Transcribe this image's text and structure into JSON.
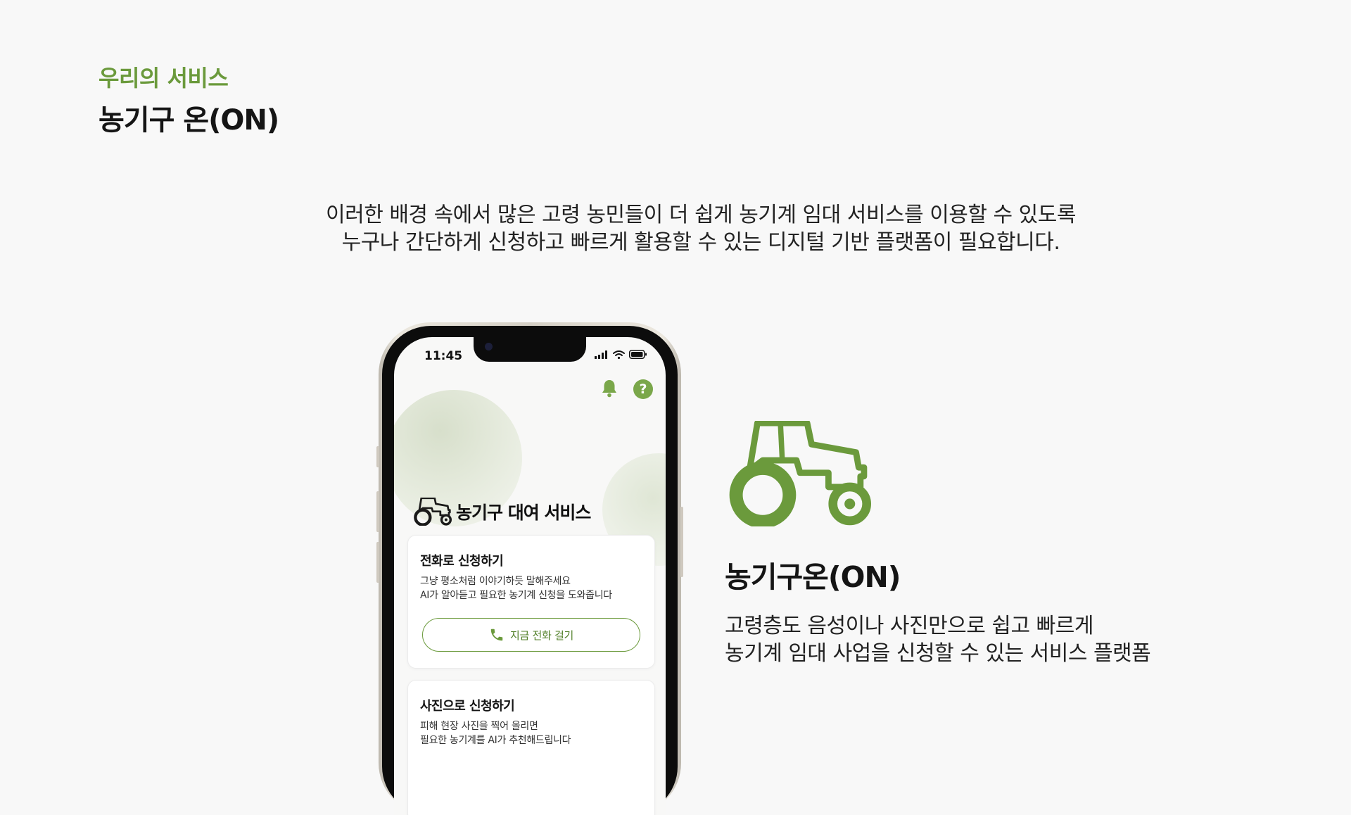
{
  "header": {
    "eyebrow": "우리의 서비스",
    "title": "농기구 온(ON)"
  },
  "intro": {
    "line1": "이러한 배경 속에서 많은 고령 농민들이 더 쉽게 농기계 임대 서비스를 이용할 수 있도록",
    "line2": "누구나 간단하게 신청하고 빠르게 활용할 수 있는 디지털 기반 플랫폼이 필요합니다."
  },
  "phone": {
    "status_time": "11:45",
    "app_title": "농기구 대여 서비스",
    "help_glyph": "?",
    "cards": [
      {
        "title": "전화로 신청하기",
        "desc_line1": "그냥 평소처럼 이야기하듯 말해주세요",
        "desc_line2": "AI가 알아듣고 필요한 농기계 신청을 도와줍니다",
        "button_label": "지금 전화 걸기"
      },
      {
        "title": "사진으로 신청하기",
        "desc_line1": "피해 현장 사진을 찍어 올리면",
        "desc_line2": "필요한 농기계를 AI가 추천해드립니다"
      }
    ]
  },
  "service": {
    "name": "농기구온(ON)",
    "desc_line1": "고령층도 음성이나 사진만으로 쉽고 빠르게",
    "desc_line2": "농기계 임대 사업을 신청할 수 있는 서비스 플랫폼"
  },
  "icons": {
    "tractor": "tractor-icon",
    "bell": "bell-icon",
    "help": "help-icon",
    "phone": "phone-icon",
    "signal": "signal-icon",
    "wifi": "wifi-icon",
    "battery": "battery-icon"
  },
  "colors": {
    "accent": "#6b9a3c",
    "background": "#f8f8f8",
    "text": "#151515"
  }
}
